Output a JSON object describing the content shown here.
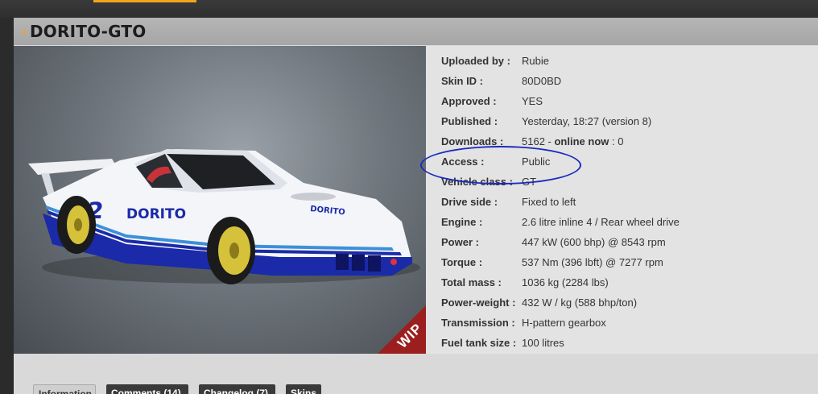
{
  "header": {
    "chevron": "›",
    "title": "DORITO-GTO"
  },
  "car_view": {
    "wip_badge": "WIP"
  },
  "info": {
    "rows": [
      {
        "label": "Uploaded by :",
        "value": "Rubie"
      },
      {
        "label": "Skin ID :",
        "value": "80D0BD"
      },
      {
        "label": "Approved :",
        "value": "YES"
      },
      {
        "label": "Published :",
        "value": "Yesterday, 18:27 (version 8)"
      },
      {
        "label": "Downloads :",
        "value": "5162 - ",
        "value_bold": "online now",
        "value_suffix": " : 0"
      },
      {
        "label": "Access :",
        "value": "Public"
      },
      {
        "label": "Vehicle class :",
        "value": "GT"
      },
      {
        "label": "Drive side :",
        "value": "Fixed to left"
      },
      {
        "label": "Engine :",
        "value": "2.6 litre inline 4 / Rear wheel drive"
      },
      {
        "label": "Power :",
        "value": "447 kW (600 bhp) @ 8543 rpm"
      },
      {
        "label": "Torque :",
        "value": "537 Nm (396 lbft) @ 7277 rpm"
      },
      {
        "label": "Total mass :",
        "value": "1036 kg (2284 lbs)"
      },
      {
        "label": "Power-weight :",
        "value": "432 W / kg (588 bhp/ton)"
      },
      {
        "label": "Transmission :",
        "value": "H-pattern gearbox"
      },
      {
        "label": "Fuel tank size :",
        "value": "100 litres"
      }
    ]
  },
  "tabs": [
    {
      "label": "Information"
    },
    {
      "label": "Comments (14)"
    },
    {
      "label": "Changelog (7)"
    },
    {
      "label": "Skins"
    }
  ],
  "colors": {
    "accent": "#f0a020",
    "annotation": "#1a2bbf",
    "wip": "#9b1f1f"
  }
}
